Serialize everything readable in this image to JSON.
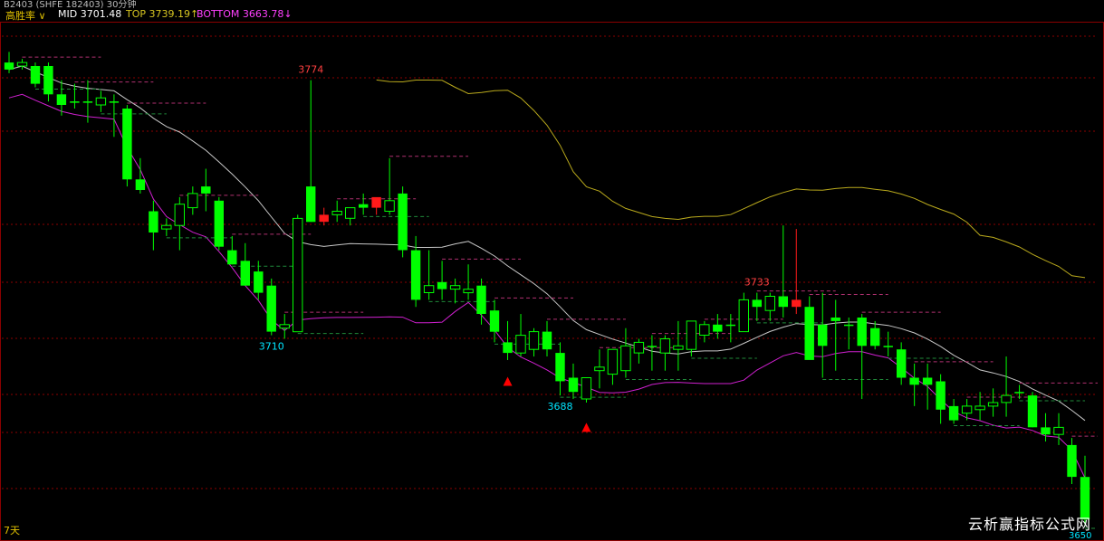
{
  "header": {
    "title_clipped": "B2403  (SHFE 182403)  30分钟",
    "indicator": "高胜率",
    "mid_label": "MID",
    "mid_value": "3701.48",
    "top_label": "TOP",
    "top_value": "3739.19",
    "top_arrow": "↑",
    "bottom_label": "BOTTOM",
    "bottom_value": "3663.78",
    "bottom_arrow": "↓"
  },
  "footer": {
    "period": "7天",
    "last_price": "3650"
  },
  "watermark": "云析赢指标公式网",
  "colors": {
    "background": "#000000",
    "up_candle": "#ff1a1a",
    "down_candle": "#00ff00",
    "hollow_up_candle": "#00ff00",
    "mid_line": "#c8c8c8",
    "top_line": "#b9a91c",
    "bottom_line": "#d020d0",
    "grid": "#8b0000",
    "high_label": "#ff4040",
    "low_label": "#00e5ff",
    "signal": "#ff0000"
  },
  "chart_data": {
    "type": "candlestick",
    "ylim": [
      3648,
      3790
    ],
    "ohlc": [
      [
        3779,
        3782,
        3776,
        3777
      ],
      [
        3778,
        3780,
        3777,
        3779
      ],
      [
        3778,
        3779,
        3772,
        3773
      ],
      [
        3778,
        3779,
        3768,
        3770
      ],
      [
        3770,
        3774,
        3764,
        3767
      ],
      [
        3768,
        3773,
        3766,
        3768
      ],
      [
        3768,
        3774,
        3762,
        3768
      ],
      [
        3767,
        3771,
        3765,
        3769
      ],
      [
        3768,
        3770,
        3758,
        3768
      ],
      [
        3766,
        3767,
        3744,
        3746
      ],
      [
        3746,
        3752,
        3742,
        3743
      ],
      [
        3737,
        3740,
        3726,
        3731
      ],
      [
        3732,
        3735,
        3730,
        3733
      ],
      [
        3733,
        3741,
        3726,
        3739
      ],
      [
        3738,
        3744,
        3736,
        3742
      ],
      [
        3744,
        3749,
        3737,
        3742
      ],
      [
        3740,
        3741,
        3726,
        3727
      ],
      [
        3726,
        3730,
        3722,
        3722
      ],
      [
        3723,
        3728,
        3718,
        3716
      ],
      [
        3720,
        3723,
        3712,
        3714
      ],
      [
        3716,
        3718,
        3702,
        3703
      ],
      [
        3704,
        3708,
        3701,
        3705
      ],
      [
        3703,
        3736,
        3703,
        3735
      ],
      [
        3744,
        3774,
        3734,
        3734
      ],
      [
        3734,
        3738,
        3733,
        3736
      ],
      [
        3736,
        3740,
        3734,
        3737
      ],
      [
        3735,
        3738,
        3733,
        3738
      ],
      [
        3739,
        3742,
        3736,
        3738
      ],
      [
        3738,
        3740,
        3736,
        3741
      ],
      [
        3737,
        3752,
        3736,
        3740
      ],
      [
        3742,
        3744,
        3724,
        3726
      ],
      [
        3726,
        3730,
        3710,
        3712
      ],
      [
        3714,
        3726,
        3712,
        3716
      ],
      [
        3717,
        3723,
        3712,
        3715
      ],
      [
        3715,
        3718,
        3711,
        3716
      ],
      [
        3714,
        3722,
        3712,
        3715
      ],
      [
        3716,
        3718,
        3705,
        3708
      ],
      [
        3709,
        3712,
        3700,
        3703
      ],
      [
        3700,
        3706,
        3695,
        3697
      ],
      [
        3697,
        3708,
        3696,
        3702
      ],
      [
        3698,
        3704,
        3696,
        3703
      ],
      [
        3703,
        3706,
        3696,
        3698
      ],
      [
        3697,
        3700,
        3685,
        3689
      ],
      [
        3690,
        3694,
        3684,
        3686
      ],
      [
        3684,
        3690,
        3683,
        3690
      ],
      [
        3692,
        3698,
        3687,
        3693
      ],
      [
        3691,
        3696,
        3688,
        3698
      ],
      [
        3692,
        3704,
        3690,
        3699
      ],
      [
        3697,
        3701,
        3694,
        3700
      ],
      [
        3699,
        3702,
        3692,
        3699
      ],
      [
        3697,
        3702,
        3692,
        3701
      ],
      [
        3698,
        3706,
        3692,
        3699
      ],
      [
        3698,
        3706,
        3696,
        3706
      ],
      [
        3702,
        3706,
        3700,
        3705
      ],
      [
        3705,
        3708,
        3701,
        3703
      ],
      [
        3705,
        3708,
        3700,
        3705
      ],
      [
        3703,
        3714,
        3705,
        3712
      ],
      [
        3712,
        3714,
        3706,
        3710
      ],
      [
        3709,
        3714,
        3706,
        3713
      ],
      [
        3713,
        3733,
        3707,
        3710
      ],
      [
        3710,
        3732,
        3708,
        3712
      ],
      [
        3710,
        3713,
        3704,
        3695
      ],
      [
        3705,
        3714,
        3690,
        3699
      ],
      [
        3707,
        3712,
        3692,
        3706
      ],
      [
        3705,
        3707,
        3698,
        3705
      ],
      [
        3707,
        3708,
        3684,
        3699
      ],
      [
        3704,
        3706,
        3698,
        3699
      ],
      [
        3699,
        3703,
        3696,
        3699
      ],
      [
        3698,
        3700,
        3688,
        3690
      ],
      [
        3690,
        3694,
        3682,
        3688
      ],
      [
        3690,
        3694,
        3681,
        3688
      ],
      [
        3689,
        3691,
        3677,
        3681
      ],
      [
        3682,
        3684,
        3677,
        3678
      ],
      [
        3680,
        3684,
        3678,
        3682
      ],
      [
        3681,
        3686,
        3678,
        3682
      ],
      [
        3682,
        3687,
        3679,
        3683
      ],
      [
        3683,
        3696,
        3679,
        3685
      ],
      [
        3686,
        3688,
        3684,
        3686
      ],
      [
        3685,
        3686,
        3676,
        3676
      ],
      [
        3676,
        3680,
        3672,
        3674
      ],
      [
        3674,
        3680,
        3671,
        3676
      ],
      [
        3671,
        3673,
        3660,
        3662
      ],
      [
        3662,
        3668,
        3648,
        3650
      ]
    ],
    "annotations": [
      {
        "text": "3774",
        "kind": "high",
        "index": 23
      },
      {
        "text": "3710",
        "kind": "low",
        "index": 20
      },
      {
        "text": "3688",
        "kind": "low",
        "index": 42
      },
      {
        "text": "3733",
        "kind": "high",
        "index": 57
      }
    ]
  }
}
